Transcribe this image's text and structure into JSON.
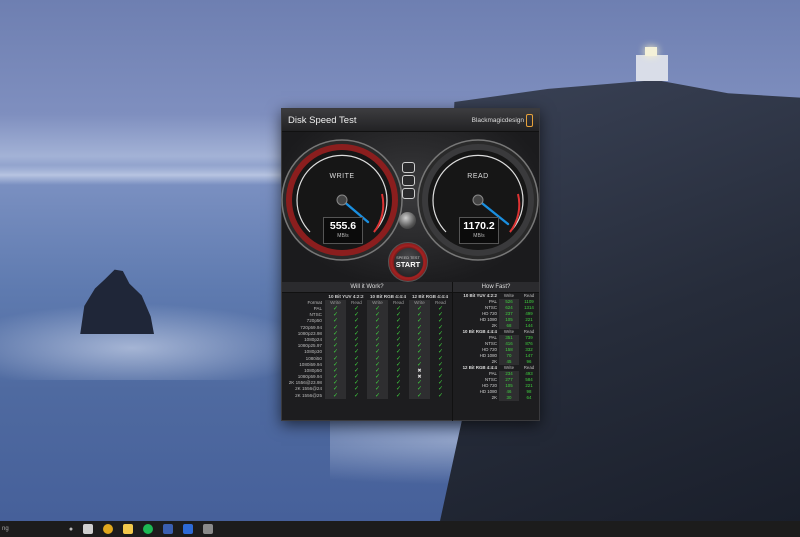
{
  "window": {
    "title": "Disk Speed Test",
    "brand": "Blackmagicdesign"
  },
  "write_gauge": {
    "label": "WRITE",
    "value": "555.6",
    "unit": "MB/s"
  },
  "read_gauge": {
    "label": "READ",
    "value": "1170.2",
    "unit": "MB/s"
  },
  "start_button": {
    "small_label": "SPEED TEST",
    "label": "START"
  },
  "will_it_work": {
    "header": "Will it Work?",
    "group_headers": [
      "10 Bit YUV 4:2:2",
      "10 Bit RGB 4:4:4",
      "12 Bit RGB 4:4:4"
    ],
    "format_label": "Format",
    "col_labels": [
      "Write",
      "Read",
      "Write",
      "Read",
      "Write",
      "Read"
    ],
    "rows": [
      {
        "format": "PAL",
        "cells": [
          "y",
          "y",
          "y",
          "y",
          "y",
          "y"
        ]
      },
      {
        "format": "NTSC",
        "cells": [
          "y",
          "y",
          "y",
          "y",
          "y",
          "y"
        ]
      },
      {
        "format": "720p50",
        "cells": [
          "y",
          "y",
          "y",
          "y",
          "y",
          "y"
        ]
      },
      {
        "format": "720p59.94",
        "cells": [
          "y",
          "y",
          "y",
          "y",
          "y",
          "y"
        ]
      },
      {
        "format": "1080p23.98",
        "cells": [
          "y",
          "y",
          "y",
          "y",
          "y",
          "y"
        ]
      },
      {
        "format": "1080p24",
        "cells": [
          "y",
          "y",
          "y",
          "y",
          "y",
          "y"
        ]
      },
      {
        "format": "1080p25.97",
        "cells": [
          "y",
          "y",
          "y",
          "y",
          "y",
          "y"
        ]
      },
      {
        "format": "1080p30",
        "cells": [
          "y",
          "y",
          "y",
          "y",
          "y",
          "y"
        ]
      },
      {
        "format": "1080i50",
        "cells": [
          "y",
          "y",
          "y",
          "y",
          "y",
          "y"
        ]
      },
      {
        "format": "1080i59.94",
        "cells": [
          "y",
          "y",
          "y",
          "y",
          "y",
          "y"
        ]
      },
      {
        "format": "1080p50",
        "cells": [
          "y",
          "y",
          "y",
          "y",
          "x",
          "y"
        ]
      },
      {
        "format": "1080p59.94",
        "cells": [
          "y",
          "y",
          "y",
          "y",
          "x",
          "y"
        ]
      },
      {
        "format": "2K 1556@23.98",
        "cells": [
          "y",
          "y",
          "y",
          "y",
          "y",
          "y"
        ]
      },
      {
        "format": "2K 1556@24",
        "cells": [
          "y",
          "y",
          "y",
          "y",
          "y",
          "y"
        ]
      },
      {
        "format": "2K 1556@25",
        "cells": [
          "y",
          "y",
          "y",
          "y",
          "y",
          "y"
        ]
      }
    ]
  },
  "how_fast": {
    "header": "How Fast?",
    "groups": [
      {
        "title": "10 Bit YUV 4:2:2",
        "write_label": "Write",
        "read_label": "Read",
        "rows": [
          {
            "name": "PAL",
            "write": "526",
            "read": "1109"
          },
          {
            "name": "NTSC",
            "write": "624",
            "read": "1314"
          },
          {
            "name": "HD 720",
            "write": "237",
            "read": "499"
          },
          {
            "name": "HD 1080",
            "write": "105",
            "read": "221"
          },
          {
            "name": "2K",
            "write": "68",
            "read": "144"
          }
        ]
      },
      {
        "title": "10 Bit RGB 4:4:4",
        "write_label": "Write",
        "read_label": "Read",
        "rows": [
          {
            "name": "PAL",
            "write": "351",
            "read": "739"
          },
          {
            "name": "NTSC",
            "write": "416",
            "read": "876"
          },
          {
            "name": "HD 720",
            "write": "158",
            "read": "332"
          },
          {
            "name": "HD 1080",
            "write": "70",
            "read": "147"
          },
          {
            "name": "2K",
            "write": "45",
            "read": "96"
          }
        ]
      },
      {
        "title": "12 Bit RGB 4:4:4",
        "write_label": "Write",
        "read_label": "Read",
        "rows": [
          {
            "name": "PAL",
            "write": "234",
            "read": "493"
          },
          {
            "name": "NTSC",
            "write": "277",
            "read": "584"
          },
          {
            "name": "HD 720",
            "write": "105",
            "read": "221"
          },
          {
            "name": "HD 1080",
            "write": "46",
            "read": "98"
          },
          {
            "name": "2K",
            "write": "30",
            "read": "64"
          }
        ]
      }
    ]
  },
  "taskbar": {
    "search_text": "ng",
    "icons": [
      {
        "name": "task-view-icon",
        "color": "#cfcfcf"
      },
      {
        "name": "chrome-icon",
        "color": "#e0a81e"
      },
      {
        "name": "file-explorer-icon",
        "color": "#f2c94c"
      },
      {
        "name": "spotify-icon",
        "color": "#1db954"
      },
      {
        "name": "terminal-icon",
        "color": "#3a5fb0"
      },
      {
        "name": "photoshop-icon",
        "color": "#2d6ad6"
      },
      {
        "name": "disk-speed-test-icon",
        "color": "#8a8a8a"
      }
    ]
  },
  "colors": {
    "accent_green": "#3fd23f",
    "gauge_red": "#a52222",
    "needle_blue": "#1a8fe0"
  }
}
